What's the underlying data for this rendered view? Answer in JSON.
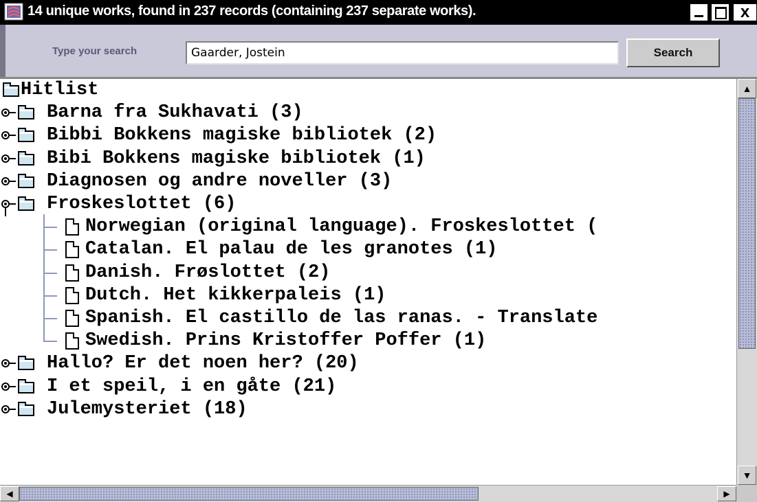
{
  "window": {
    "title": "14 unique works, found in 237 records (containing 237 separate works).",
    "minimize_icon": "minimize-icon",
    "maximize_icon": "maximize-icon",
    "close_glyph": "x"
  },
  "search": {
    "label": "Type your search",
    "value": "Gaarder, Jostein",
    "button_label": "Search"
  },
  "tree": {
    "root_label": "Hitlist",
    "works": [
      {
        "label": "Barna fra Sukhavati (3)",
        "expanded": false
      },
      {
        "label": "Bibbi Bokkens magiske bibliotek (2)",
        "expanded": false
      },
      {
        "label": "Bibi Bokkens magiske bibliotek (1)",
        "expanded": false
      },
      {
        "label": "Diagnosen og andre noveller (3)",
        "expanded": false
      },
      {
        "label": "Froskeslottet (6)",
        "expanded": true,
        "children": [
          "Norwegian (original language). Froskeslottet (",
          "Catalan. El palau de les granotes (1)",
          "Danish. Frøslottet (2)",
          "Dutch. Het kikkerpaleis (1)",
          "Spanish. El castillo de las ranas. - Translate",
          "Swedish. Prins Kristoffer Poffer (1)"
        ]
      },
      {
        "label": "Hallo? Er det noen her? (20)",
        "expanded": false
      },
      {
        "label": "I et speil, i en gåte (21)",
        "expanded": false
      },
      {
        "label": "Julemysteriet (18)",
        "expanded": false
      }
    ]
  },
  "colors": {
    "titlebar": "#000000",
    "search_panel": "#c9c9d9",
    "scroll_thumb": "#b7bdd8"
  }
}
